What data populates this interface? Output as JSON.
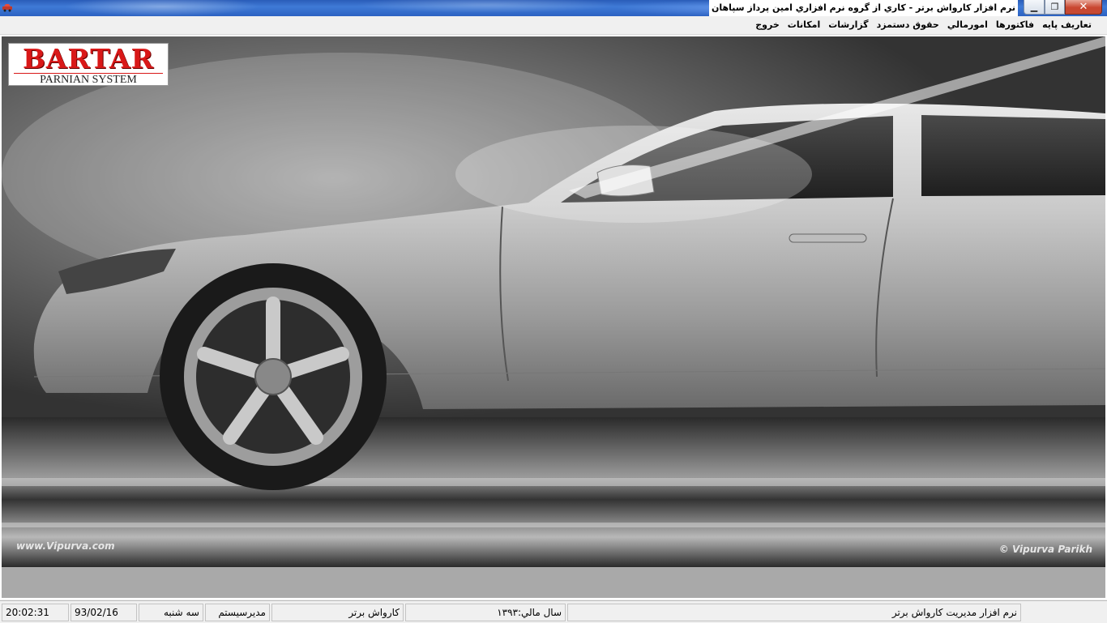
{
  "window": {
    "title": "نرم افزار كارواش برتر - كاري از گروه نرم افزاري امين پرداز سپاهان",
    "min_glyph": "▁",
    "max_glyph": "❐",
    "close_glyph": "✕"
  },
  "menu": {
    "items": [
      {
        "label": "تعاريف پايه"
      },
      {
        "label": "فاكتورها"
      },
      {
        "label": "امورمالي"
      },
      {
        "label": "حقوق دستمزد"
      },
      {
        "label": "گزارشات"
      },
      {
        "label": "امكانات"
      },
      {
        "label": "خروج"
      }
    ]
  },
  "logo": {
    "main": "BARTAR",
    "sub": "PARNIAN SYSTEM"
  },
  "photo": {
    "watermark_left": "www.Vipurva.com",
    "watermark_right": "© Vipurva Parikh"
  },
  "status": {
    "time": "20:02:31",
    "date": "93/02/16",
    "weekday": "سه شنبه",
    "user": "مديرسيستم",
    "company": "كارواش برتر",
    "fiscal_year": "سال مالي:۱۳۹۳",
    "app_name": "نرم افزار مديريت كارواش برتر"
  },
  "colors": {
    "logo_red": "#d91818",
    "titlebar_blue": "#2c62c2"
  }
}
